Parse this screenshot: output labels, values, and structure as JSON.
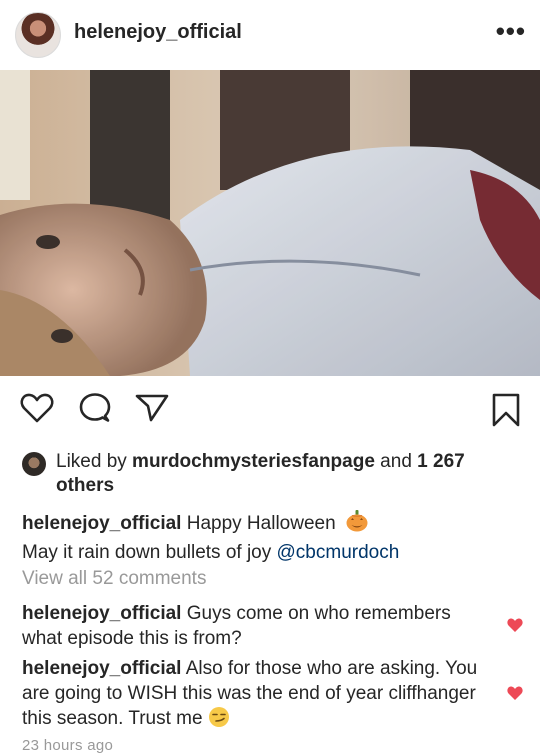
{
  "post": {
    "username": "helenejoy_official",
    "more_label": "•••"
  },
  "likes": {
    "prefix": "Liked by ",
    "liker": "murdochmysteriesfanpage",
    "middle": " and ",
    "count": "1 267",
    "suffix": " others"
  },
  "caption": {
    "username": "helenejoy_official",
    "line1": "Happy Halloween",
    "line2_prefix": "May it rain down bullets of joy ",
    "mention": "@cbcmurdoch"
  },
  "view_all_comments": "View all 52 comments",
  "comments": [
    {
      "username": "helenejoy_official",
      "text": "Guys come on who remembers what episode this is from?"
    },
    {
      "username": "helenejoy_official",
      "text": "Also for those who are asking. You are going to WISH this was the end of year cliffhanger this season. Trust me"
    }
  ],
  "timestamp": "23 hours ago",
  "icons": {
    "like": "heart-outline-icon",
    "comment": "comment-bubble-icon",
    "share": "paper-plane-icon",
    "save": "bookmark-icon",
    "comment_like": "heart-filled-icon",
    "pumpkin": "jack-o-lantern-emoji",
    "smirk": "smirk-emoji"
  },
  "colors": {
    "text": "#262626",
    "muted": "#999999",
    "mention": "#003569",
    "heart": "#ed4956"
  }
}
